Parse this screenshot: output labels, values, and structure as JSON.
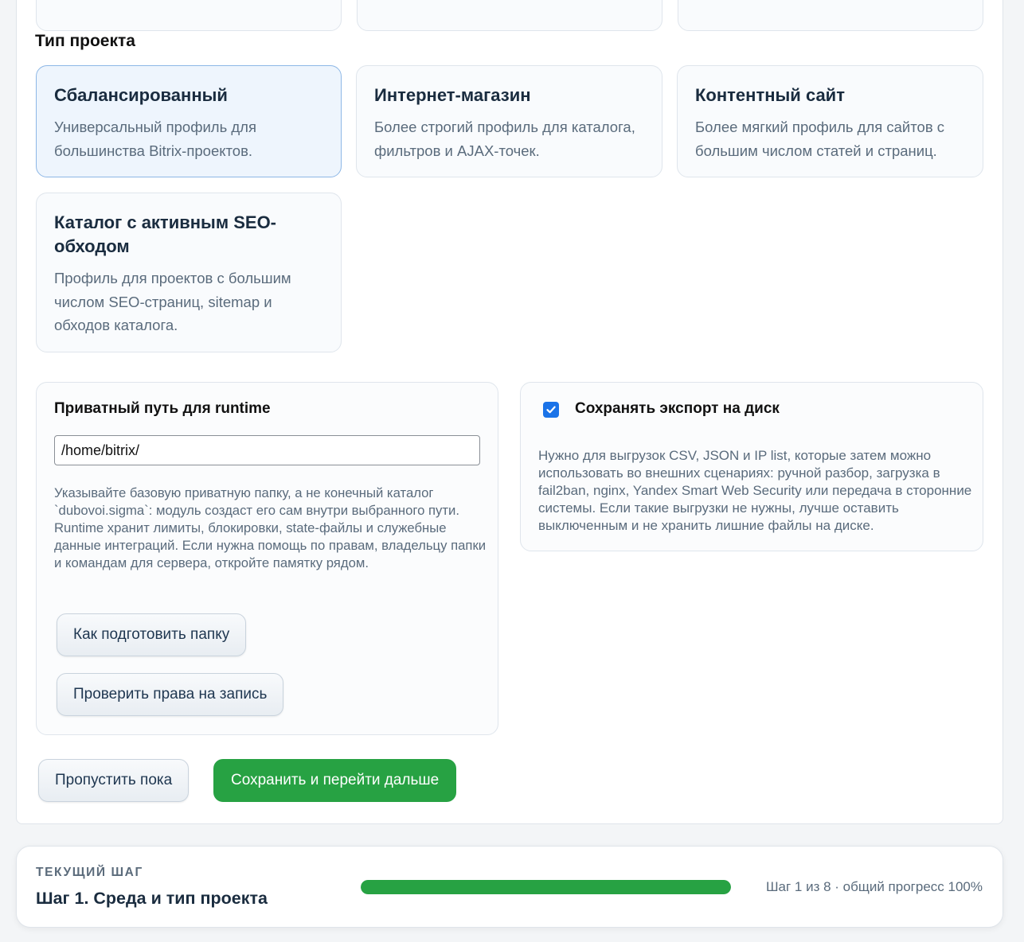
{
  "project_type": {
    "title": "Тип проекта",
    "cards": [
      {
        "title": "Сбалансированный",
        "desc": "Универсальный профиль для большинства Bitrix-проектов.",
        "selected": true
      },
      {
        "title": "Интернет-магазин",
        "desc": "Более строгий профиль для каталога, фильтров и AJAX-точек.",
        "selected": false
      },
      {
        "title": "Контентный сайт",
        "desc": "Более мягкий профиль для сайтов с большим числом статей и страниц.",
        "selected": false
      },
      {
        "title": "Каталог с активным SEO-обходом",
        "desc": "Профиль для проектов с большим числом SEO-страниц, sitemap и обходов каталога.",
        "selected": false
      }
    ]
  },
  "runtime": {
    "title": "Приватный путь для runtime",
    "path_value": "/home/bitrix/",
    "hint": "Указывайте базовую приватную папку, а не конечный каталог `dubovoi.sigma`: модуль создаст его сам внутри выбранного пути. Runtime хранит лимиты, блокировки, state-файлы и служебные данные интеграций. Если нужна помощь по правам, владельцу папки и командам для сервера, откройте памятку рядом.",
    "prepare_button": "Как подготовить папку",
    "check_button": "Проверить права на запись"
  },
  "export": {
    "label": "Сохранять экспорт на диск",
    "checked": true,
    "desc": "Нужно для выгрузок CSV, JSON и IP list, которые затем можно использовать во внешних сценариях: ручной разбор, загрузка в fail2ban, nginx, Yandex Smart Web Security или передача в сторонние системы. Если такие выгрузки не нужны, лучше оставить выключенным и не хранить лишние файлы на диске."
  },
  "actions": {
    "skip": "Пропустить пока",
    "save_next": "Сохранить и перейти дальше"
  },
  "footer": {
    "kicker": "ТЕКУЩИЙ ШАГ",
    "step_title": "Шаг 1. Среда и тип проекта",
    "progress_text": "Шаг 1 из 8 · общий прогресс 100%",
    "progress_percent": 100
  },
  "colors": {
    "accent_green": "#27a243",
    "selected_border": "#8db7e6",
    "checkbox_blue": "#1a73e8"
  }
}
